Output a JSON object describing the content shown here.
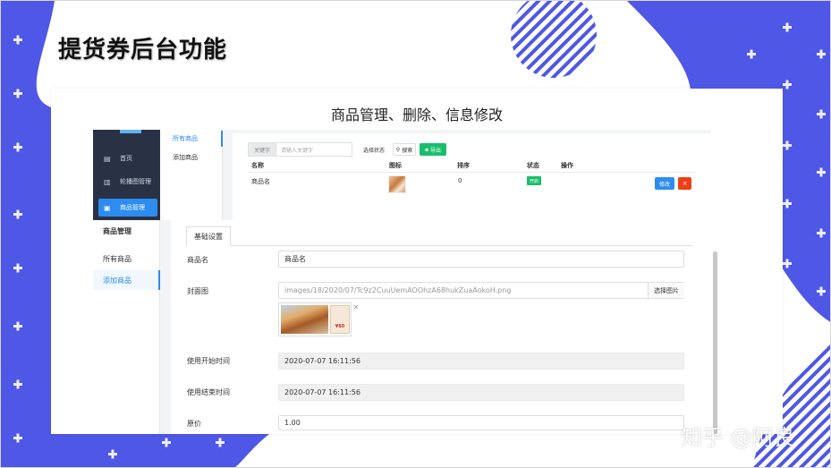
{
  "slide_title": "提货券后台功能",
  "panel_title": "商品管理、删除、信息修改",
  "watermark": "知乎 @阿良",
  "colors": {
    "brand_blue": "#4e57e6",
    "primary": "#2d8cf0",
    "success": "#19be6b",
    "danger": "#ed4014",
    "sidebar_dark": "#283244"
  },
  "top_screenshot": {
    "sidebar": {
      "items": [
        {
          "label": "首页",
          "icon": "home-icon"
        },
        {
          "label": "轮播图管理",
          "icon": "bar-chart-icon"
        },
        {
          "label": "商品管理",
          "icon": "bag-icon",
          "active": true
        }
      ]
    },
    "submenu": {
      "items": [
        {
          "label": "所有商品",
          "active": true
        },
        {
          "label": "添加商品"
        }
      ]
    },
    "search": {
      "keyword_label": "关键字",
      "keyword_placeholder": "请输入关键字",
      "status_select": "选择状态",
      "search_button": "搜索",
      "export_button": "导出"
    },
    "table": {
      "headers": [
        "名称",
        "图标",
        "排序",
        "状态",
        "操作"
      ],
      "rows": [
        {
          "name": "商品名",
          "sort": "0",
          "status": "开启",
          "edit": "修改",
          "delete": "×"
        }
      ]
    }
  },
  "bottom_screenshot": {
    "menu": {
      "title": "商品管理",
      "items": [
        {
          "label": "所有商品"
        },
        {
          "label": "添加商品",
          "active": true
        }
      ]
    },
    "tab": "基础设置",
    "form": {
      "name_label": "商品名",
      "name_value": "商品名",
      "cover_label": "封面图",
      "cover_path": "images/18/2020/07/Tc9z2CuuUemAOOhzA68hukZuaAokoH.png",
      "choose_image": "选择图片",
      "cover_badge": "¥80",
      "start_label": "使用开始时间",
      "start_value": "2020-07-07 16:11:56",
      "end_label": "使用结束时间",
      "end_value": "2020-07-07 16:11:56",
      "price_label": "原价",
      "price_value": "1.00"
    }
  }
}
